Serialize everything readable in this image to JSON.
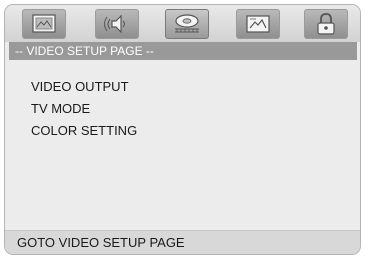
{
  "toolbar": {
    "tabs": [
      {
        "icon": "general-setup-icon",
        "active": false
      },
      {
        "icon": "audio-setup-icon",
        "active": false
      },
      {
        "icon": "video-setup-icon",
        "active": true
      },
      {
        "icon": "preference-icon",
        "active": false
      },
      {
        "icon": "password-lock-icon",
        "active": false
      }
    ]
  },
  "page": {
    "title": "-- VIDEO SETUP PAGE --"
  },
  "menu": {
    "items": [
      {
        "label": "VIDEO OUTPUT"
      },
      {
        "label": "TV MODE"
      },
      {
        "label": "COLOR SETTING"
      }
    ]
  },
  "status": {
    "text": "GOTO VIDEO SETUP PAGE"
  },
  "colors": {
    "panel_bg": "#ececec",
    "title_bar_bg": "#999999",
    "status_bar_bg": "#d8d8d8",
    "text": "#1a1a1a"
  }
}
